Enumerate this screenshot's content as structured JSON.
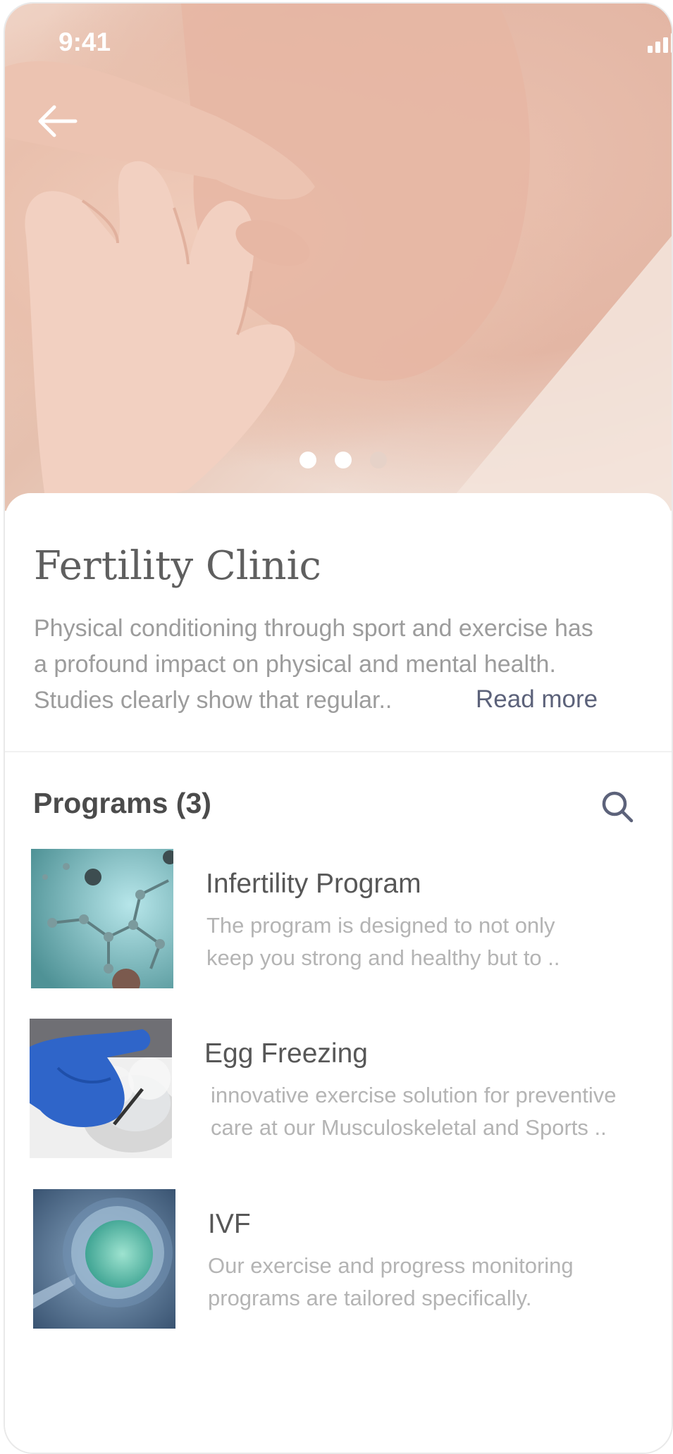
{
  "status_bar": {
    "time": "9:41"
  },
  "hero": {
    "carousel": {
      "count": 3,
      "active_index": 2
    }
  },
  "clinic": {
    "title": "Fertility Clinic",
    "description_lines": [
      "Physical conditioning through sport and exercise has",
      "a profound impact on physical and mental health.",
      "Studies clearly show that regular.."
    ],
    "read_more": "Read more"
  },
  "programs": {
    "heading": "Programs (3)",
    "items": [
      {
        "title": "Infertility Program",
        "lines": [
          "The program is designed to not only",
          "keep you strong and healthy but to .."
        ]
      },
      {
        "title": "Egg Freezing",
        "lines": [
          "innovative exercise solution for preventive",
          "care at our Musculoskeletal and Sports .."
        ]
      },
      {
        "title": "IVF",
        "lines": [
          "Our exercise and progress monitoring",
          "programs are tailored specifically."
        ]
      }
    ]
  },
  "colors": {
    "accent": "#5c627a",
    "title": "#5f5f5f",
    "body_text": "#9c9c9c",
    "muted_text": "#b4b4b4"
  }
}
